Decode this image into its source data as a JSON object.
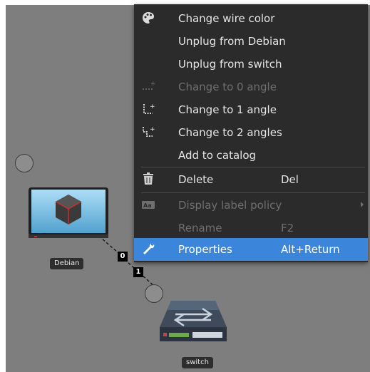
{
  "canvas": {
    "nodes": [
      {
        "label": "Debian",
        "icon": "computer-icon"
      },
      {
        "label": "switch",
        "icon": "switch-icon"
      }
    ],
    "ports": [
      "0",
      "1"
    ]
  },
  "context_menu": {
    "items": [
      {
        "label": "Change wire color",
        "icon": "palette-icon",
        "shortcut": ""
      },
      {
        "label": "Unplug from Debian",
        "icon": "",
        "shortcut": ""
      },
      {
        "label": "Unplug from switch",
        "icon": "",
        "shortcut": ""
      },
      {
        "label": "Change to 0 angle",
        "icon": "wire-0-angle-icon",
        "shortcut": "",
        "disabled": true
      },
      {
        "label": "Change to 1 angle",
        "icon": "wire-1-angle-icon",
        "shortcut": ""
      },
      {
        "label": "Change to 2 angles",
        "icon": "wire-2-angle-icon",
        "shortcut": ""
      },
      {
        "label": "Add to catalog",
        "icon": "",
        "shortcut": ""
      },
      {
        "label": "Delete",
        "icon": "trash-icon",
        "shortcut": "Del"
      },
      {
        "label": "Display label policy",
        "icon": "label-policy-icon",
        "shortcut": "",
        "disabled": true
      },
      {
        "label": "Rename",
        "icon": "",
        "shortcut": "F2",
        "disabled": true
      },
      {
        "label": "Properties",
        "icon": "wrench-icon",
        "shortcut": "Alt+Return",
        "selected": true
      }
    ]
  },
  "colors": {
    "canvas": "#7e7e7e",
    "menu_bg": "#2b2b2b",
    "highlight": "#3b86db"
  }
}
